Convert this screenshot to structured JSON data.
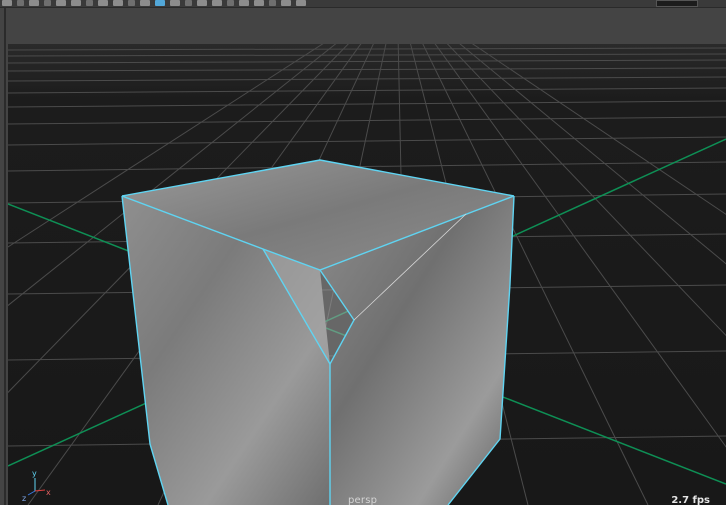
{
  "viewport": {
    "camera_label": "persp",
    "fps_readout": "2.7 fps",
    "axis_labels": {
      "y": "y",
      "z": "z",
      "x": "x"
    },
    "colors": {
      "background": "#1a1a1a",
      "grid": "#4a4a4a",
      "axis_green": "#0e8f55",
      "selection_wire": "#5fd4f2",
      "cube_face": "#8a8a8a"
    }
  },
  "toolbar": {
    "icons": [
      "select-icon",
      "move-icon",
      "rotate-icon",
      "snap-icon",
      "grid-icon",
      "camera-icon",
      "wireframe-icon",
      "shaded-icon",
      "light-icon",
      "texture-icon",
      "isolate-icon",
      "xray-icon",
      "resolution-icon",
      "render-icon"
    ]
  }
}
